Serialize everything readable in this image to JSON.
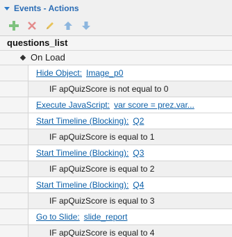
{
  "panel": {
    "title": "Events - Actions"
  },
  "toolbar": {
    "buttons": [
      {
        "icon": "add-icon",
        "color": "#7fc27f"
      },
      {
        "icon": "delete-icon",
        "color": "#e38b8b"
      },
      {
        "icon": "edit-icon",
        "color": "#e8c35a"
      },
      {
        "icon": "move-up-icon",
        "color": "#8db6de"
      },
      {
        "icon": "move-down-icon",
        "color": "#8db6de"
      }
    ]
  },
  "list": {
    "root": "questions_list",
    "event": "On Load",
    "rows": [
      {
        "type": "action",
        "action": "Hide Object:",
        "target": "Image_p0"
      },
      {
        "type": "cond",
        "text": "IF apQuizScore is not equal to 0"
      },
      {
        "type": "action",
        "action": "Execute JavaScript:",
        "target": "var score = prez.var..."
      },
      {
        "type": "action",
        "action": "Start Timeline (Blocking):",
        "target": "Q2"
      },
      {
        "type": "cond",
        "text": "IF apQuizScore is equal to 1"
      },
      {
        "type": "action",
        "action": "Start Timeline (Blocking):",
        "target": "Q3"
      },
      {
        "type": "cond",
        "text": "IF apQuizScore is equal to 2"
      },
      {
        "type": "action",
        "action": "Start Timeline (Blocking):",
        "target": "Q4"
      },
      {
        "type": "cond",
        "text": "IF apQuizScore is equal to 3"
      },
      {
        "type": "action",
        "action": "Go to Slide:",
        "target": "slide_report"
      },
      {
        "type": "cond",
        "text": "IF apQuizScore is equal to 4"
      }
    ]
  }
}
